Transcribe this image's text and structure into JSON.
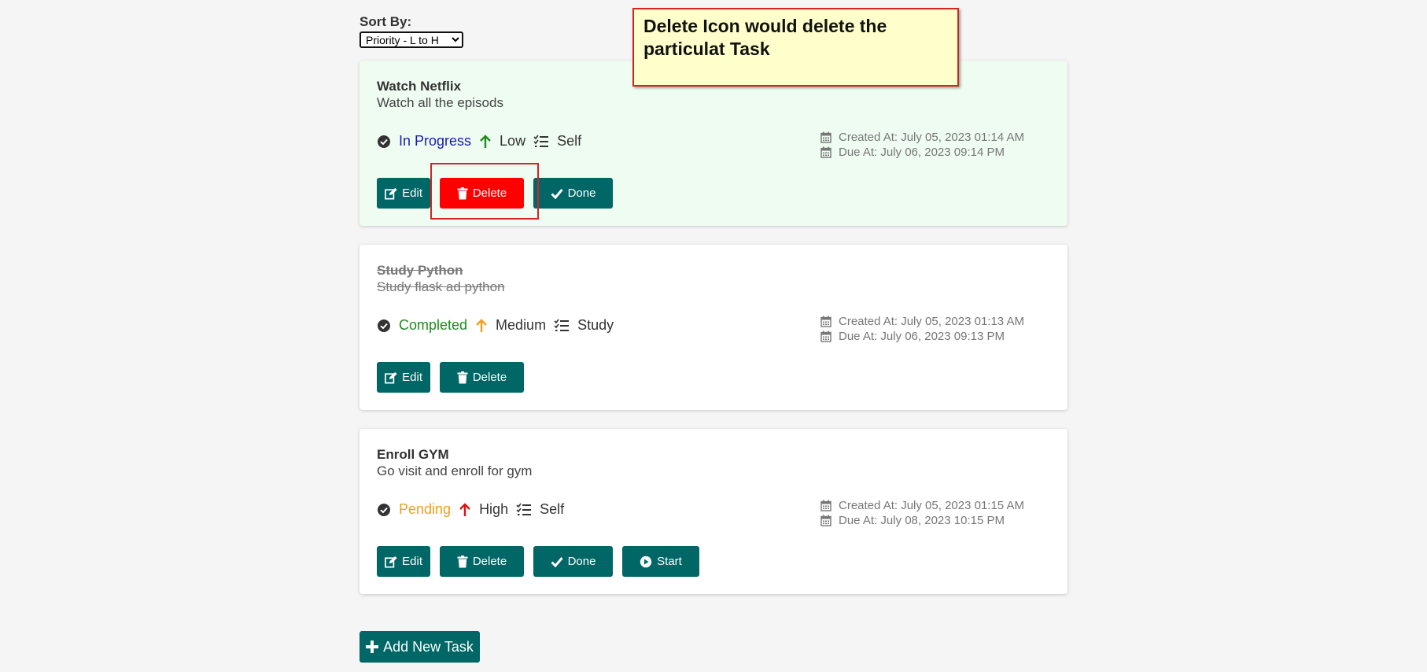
{
  "sort": {
    "label": "Sort By:",
    "selected": "Priority - L to H"
  },
  "annotation": {
    "text": "Delete Icon would delete the particulat Task"
  },
  "tasks": [
    {
      "title": "Watch Netflix",
      "description": "Watch all the episods",
      "status": "In Progress",
      "status_color": "#1a1ab8",
      "priority": "Low",
      "priority_color": "#1e8c1e",
      "category": "Self",
      "created": "Created At: July 05, 2023 01:14 AM",
      "due": "Due At: July 06, 2023 09:14 PM",
      "buttons": {
        "edit": "Edit",
        "delete": "Delete",
        "done": "Done"
      }
    },
    {
      "title": "Study Python",
      "description": "Study flask ad python",
      "status": "Completed",
      "status_color": "#1e8c1e",
      "priority": "Medium",
      "priority_color": "#f0a020",
      "category": "Study",
      "created": "Created At: July 05, 2023 01:13 AM",
      "due": "Due At: July 06, 2023 09:13 PM",
      "buttons": {
        "edit": "Edit",
        "delete": "Delete"
      }
    },
    {
      "title": "Enroll GYM",
      "description": "Go visit and enroll for gym",
      "status": "Pending",
      "status_color": "#f0a020",
      "priority": "High",
      "priority_color": "#e01010",
      "category": "Self",
      "created": "Created At: July 05, 2023 01:15 AM",
      "due": "Due At: July 08, 2023 10:15 PM",
      "buttons": {
        "edit": "Edit",
        "delete": "Delete",
        "done": "Done",
        "start": "Start"
      }
    }
  ],
  "add_task": {
    "label": "Add New Task"
  },
  "colors": {
    "accent": "#006666",
    "danger": "#ff0000",
    "annotation_bg": "#ffffcc"
  }
}
